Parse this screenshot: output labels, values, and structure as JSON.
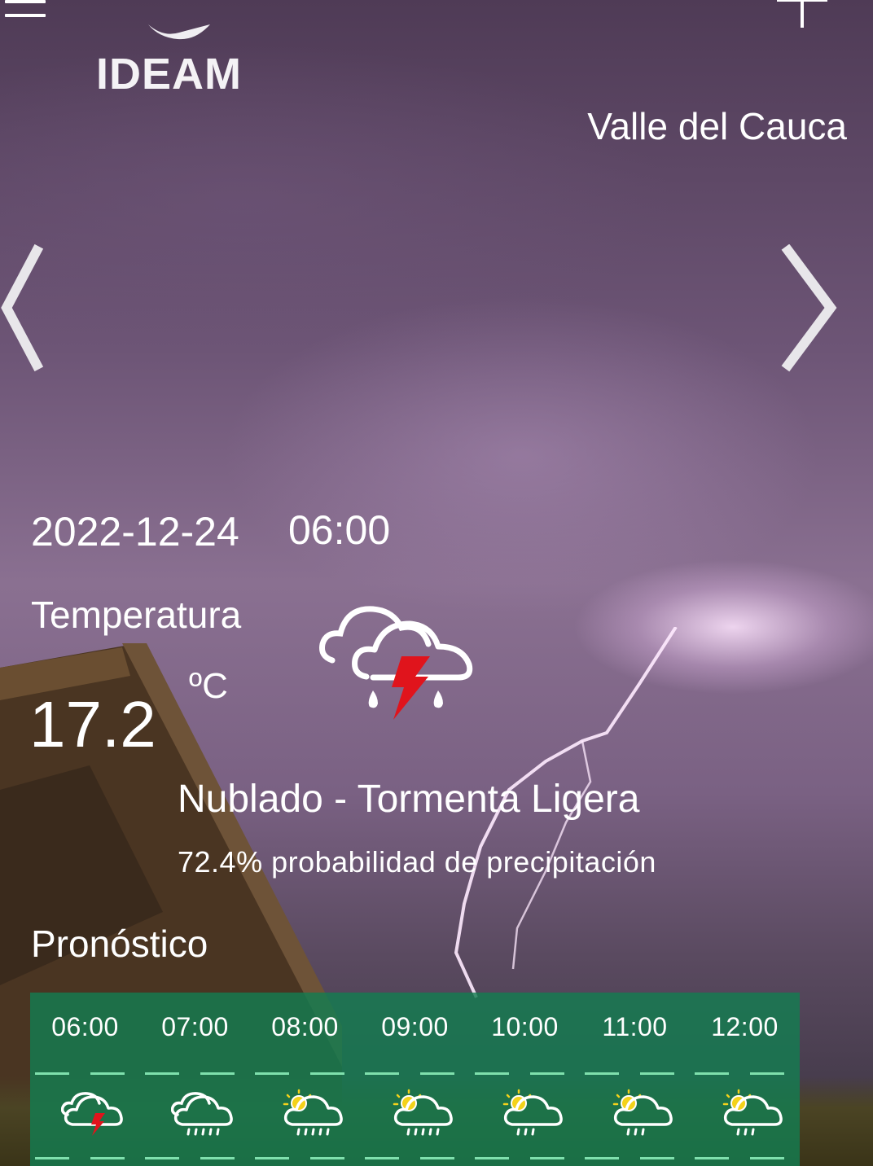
{
  "header": {
    "logo_text": "IDEAM",
    "region": "Valle del Cauca"
  },
  "current": {
    "date": "2022-12-24",
    "time": "06:00",
    "temperature_label": "Temperatura",
    "temperature_unit": "ºC",
    "temperature_value": "17.2",
    "condition": "Nublado - Tormenta Ligera",
    "precipitation": "72.4% probabilidad de precipitación",
    "icon": "cloud-thunderstorm-rain-icon"
  },
  "forecast": {
    "title": "Pronóstico",
    "hours": [
      {
        "time": "06:00",
        "icon": "cloud-thunderstorm-icon"
      },
      {
        "time": "07:00",
        "icon": "cloud-rain-icon"
      },
      {
        "time": "08:00",
        "icon": "sun-cloud-rain-icon"
      },
      {
        "time": "09:00",
        "icon": "sun-cloud-rain-icon"
      },
      {
        "time": "10:00",
        "icon": "sun-cloud-drizzle-icon"
      },
      {
        "time": "11:00",
        "icon": "sun-cloud-drizzle-icon"
      },
      {
        "time": "12:00",
        "icon": "sun-cloud-drizzle-icon"
      }
    ]
  },
  "colors": {
    "forecast_panel": "#147d50",
    "dash": "#7fe0ad",
    "lightning_icon": "#e0141c"
  }
}
